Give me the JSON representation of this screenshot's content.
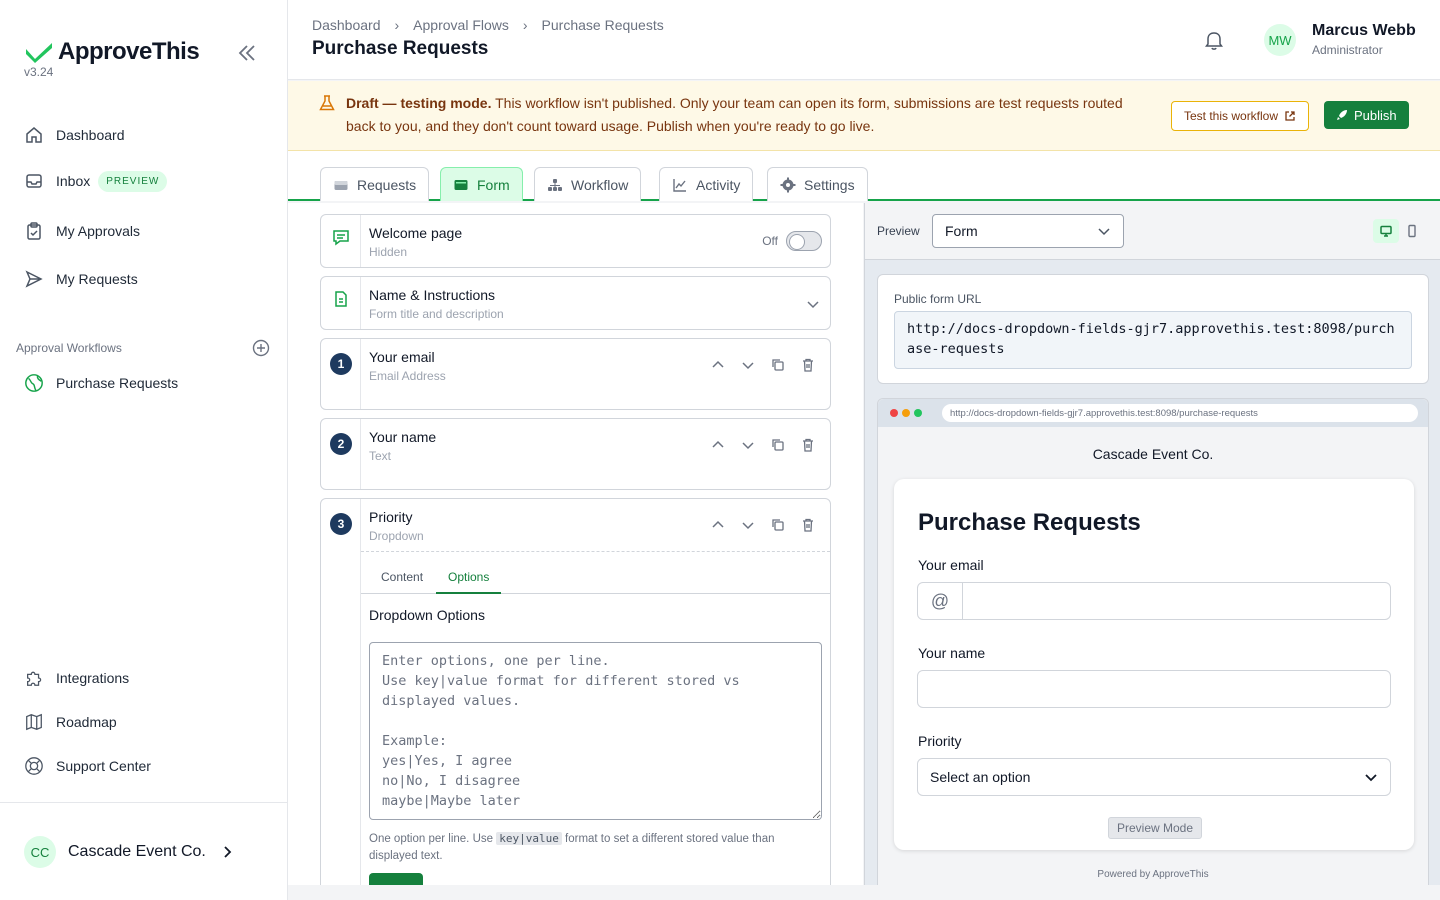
{
  "app": {
    "name": "ApproveThis",
    "version": "v3.24"
  },
  "sidebar": {
    "nav": [
      {
        "label": "Dashboard",
        "icon": "home-icon"
      },
      {
        "label": "Inbox",
        "icon": "inbox-icon",
        "badge": "PREVIEW"
      },
      {
        "label": "My Approvals",
        "icon": "clipboard-check-icon"
      },
      {
        "label": "My Requests",
        "icon": "send-icon"
      }
    ],
    "section_label": "Approval Workflows",
    "workflows": [
      {
        "label": "Purchase Requests",
        "icon": "globe-icon"
      }
    ],
    "bottom": [
      {
        "label": "Integrations",
        "icon": "puzzle-icon"
      },
      {
        "label": "Roadmap",
        "icon": "map-icon"
      },
      {
        "label": "Support Center",
        "icon": "life-ring-icon"
      }
    ],
    "org": {
      "initials": "CC",
      "name": "Cascade Event Co."
    }
  },
  "header": {
    "breadcrumbs": [
      "Dashboard",
      "Approval Flows",
      "Purchase Requests"
    ],
    "title": "Purchase Requests",
    "user": {
      "initials": "MW",
      "name": "Marcus Webb",
      "role": "Administrator"
    }
  },
  "banner": {
    "bold": "Draft — testing mode.",
    "text": " This workflow isn't published. Only your team can open its form, submissions are test requests routed back to you, and they don't count toward usage. Publish when you're ready to go live.",
    "test_button": "Test this workflow",
    "publish_button": "Publish"
  },
  "tabs": [
    {
      "label": "Requests",
      "icon": "inbox-tray-icon"
    },
    {
      "label": "Form",
      "icon": "form-icon",
      "active": true
    },
    {
      "label": "Workflow",
      "icon": "workflow-icon"
    },
    {
      "label": "Activity",
      "icon": "chart-line-icon"
    },
    {
      "label": "Settings",
      "icon": "gear-icon"
    }
  ],
  "builder": {
    "welcome": {
      "title": "Welcome page",
      "sub": "Hidden",
      "toggle_label": "Off"
    },
    "name_instructions": {
      "title": "Name & Instructions",
      "sub": "Form title and description"
    },
    "fields": [
      {
        "num": "1",
        "title": "Your email",
        "sub": "Email Address"
      },
      {
        "num": "2",
        "title": "Your name",
        "sub": "Text"
      },
      {
        "num": "3",
        "title": "Priority",
        "sub": "Dropdown"
      }
    ],
    "sub_tabs": [
      "Content",
      "Options"
    ],
    "dropdown_label": "Dropdown Options",
    "dropdown_placeholder": "Enter options, one per line.\nUse key|value format for different stored vs displayed values.\n\nExample:\nyes|Yes, I agree\nno|No, I disagree\nmaybe|Maybe later",
    "help_before": "One option per line. Use ",
    "help_code": "key|value",
    "help_after": " format to set a different stored value than displayed text."
  },
  "preview": {
    "label": "Preview",
    "select_value": "Form",
    "url_label": "Public form URL",
    "url": "http://docs-dropdown-fields-gjr7.approvethis.test:8098/purchase-requests",
    "browser_url": "http://docs-dropdown-fields-gjr7.approvethis.test:8098/purchase-requests",
    "org_name": "Cascade Event Co.",
    "form_title": "Purchase Requests",
    "email_label": "Your email",
    "at_symbol": "@",
    "name_label": "Your name",
    "priority_label": "Priority",
    "priority_placeholder": "Select an option",
    "mode_badge": "Preview Mode",
    "powered_by": "Powered by ApproveThis"
  },
  "colors": {
    "brand": "#16a34a",
    "brand_dark": "#15803d",
    "banner_bg": "#fef9e7",
    "navy_badge": "#1e3a5f"
  }
}
